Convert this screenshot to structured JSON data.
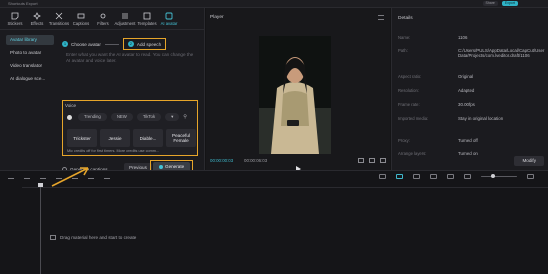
{
  "topbar": {
    "left_text": "Shortcuts  Export",
    "right_items": [
      "Share",
      "Export"
    ]
  },
  "toolbar": {
    "items": [
      {
        "label": "Stickers",
        "icon": "sticker-icon"
      },
      {
        "label": "Effects",
        "icon": "effects-icon"
      },
      {
        "label": "Transitions",
        "icon": "transitions-icon"
      },
      {
        "label": "Captions",
        "icon": "captions-icon"
      },
      {
        "label": "Filters",
        "icon": "filters-icon"
      },
      {
        "label": "Adjustment",
        "icon": "adjustment-icon"
      },
      {
        "label": "Templates",
        "icon": "templates-icon"
      },
      {
        "label": "AI avatar",
        "icon": "ai-avatar-icon"
      }
    ]
  },
  "sidemenu": {
    "items": [
      "Avatar library",
      "Photo to avatar",
      "Video translator",
      "AI dialogue sce..."
    ],
    "active": 0
  },
  "steps": {
    "step1": "Choose avatar",
    "step2": "Add speech"
  },
  "script_placeholder": "Enter what you want the AI avatar to read. You can change the AI avatar and voice later.",
  "voice": {
    "title": "Voice",
    "tabs": [
      "Trending",
      "NEW",
      "TikTok"
    ],
    "cards": [
      "Trickster",
      "Jessie",
      "Diable...",
      "Peaceful Female"
    ],
    "note": "Mic credits off for first timers. More credits use comm..."
  },
  "bottom": {
    "generate_captions": "Generate captions",
    "previous": "Previous",
    "generate": "Generate"
  },
  "player": {
    "title": "Player",
    "time_current": "00:00:00:03",
    "time_total": "00:00:06:03"
  },
  "details": {
    "title": "Details",
    "rows": [
      {
        "label": "Name:",
        "value": "1106"
      },
      {
        "label": "Path:",
        "value": "C:/Users/PULS/AppData/Local/CapCut/User Data/Projects/com.lveditor.draft/1106"
      },
      {
        "label": "Aspect ratio:",
        "value": "Original"
      },
      {
        "label": "Resolution:",
        "value": "Adapted"
      },
      {
        "label": "Frame rate:",
        "value": "30.00fps"
      },
      {
        "label": "Imported media:",
        "value": "Stay in original location"
      },
      {
        "label": "Proxy:",
        "value": "Turned off"
      },
      {
        "label": "Arrange layers:",
        "value": "Turned on"
      }
    ],
    "modify": "Modify"
  },
  "timeline": {
    "drop_hint": "Drag material here and start to create"
  },
  "colors": {
    "accent": "#2fb3c6",
    "highlight": "#e6a52a"
  }
}
